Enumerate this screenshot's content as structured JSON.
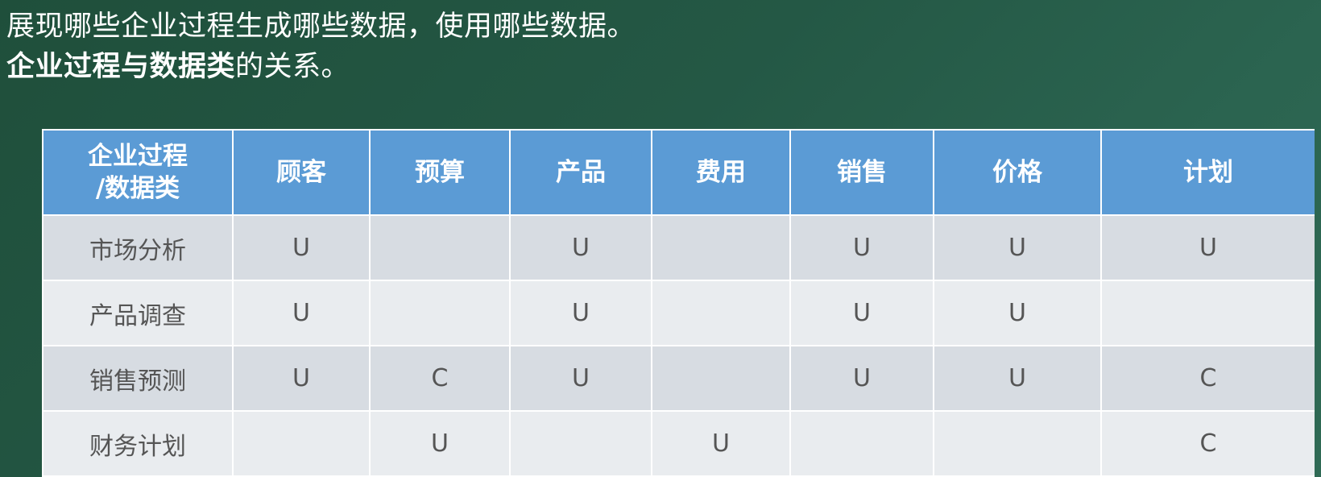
{
  "title_lines": {
    "line1": "展现哪些企业过程生成哪些数据，使用哪些数据。",
    "line2_bold": "企业过程与数据类",
    "line2_rest": "的关系。"
  },
  "table": {
    "corner_header": [
      "企业过程",
      "/数据类"
    ],
    "columns": [
      "顾客",
      "预算",
      "产品",
      "费用",
      "销售",
      "价格",
      "计划"
    ],
    "rows": [
      {
        "process": "市场分析",
        "cells": [
          "U",
          "",
          "U",
          "",
          "U",
          "U",
          "U"
        ]
      },
      {
        "process": "产品调查",
        "cells": [
          "U",
          "",
          "U",
          "",
          "U",
          "U",
          ""
        ]
      },
      {
        "process": "销售预测",
        "cells": [
          "U",
          "C",
          "U",
          "",
          "U",
          "U",
          "C"
        ]
      },
      {
        "process": "财务计划",
        "cells": [
          "",
          "U",
          "",
          "U",
          "",
          "",
          "C"
        ]
      }
    ]
  }
}
